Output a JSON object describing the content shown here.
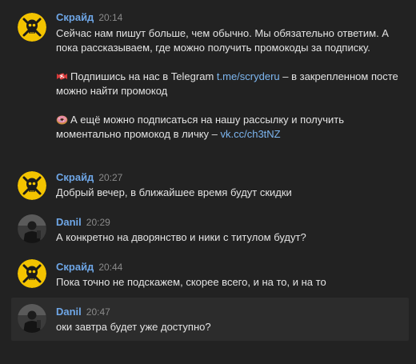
{
  "messages": [
    {
      "author": "Скрайд",
      "time": "20:14",
      "avatar": "skull-logo-avatar",
      "intro": "Сейчас нам пишут больше, чем обычно. Мы обязательно ответим. А пока рассказываем, где можно получить промокоды за подписку.",
      "promo1_emoji": "candy-icon",
      "promo1_text_before": "Подпишись на нас в Telegram ",
      "promo1_link": "t.me/scryderu",
      "promo1_text_after": " – в закрепленном посте можно найти промокод",
      "promo2_emoji": "donut-icon",
      "promo2_text_before": "А ещё можно подписаться на нашу рассылку и получить моментально промокод в личку – ",
      "promo2_link": "vk.cc/ch3tNZ"
    },
    {
      "author": "Скрайд",
      "time": "20:27",
      "avatar": "skull-logo-avatar",
      "text": "Добрый вечер, в ближайшее время будут скидки"
    },
    {
      "author": "Danil",
      "time": "20:29",
      "avatar": "user-photo-avatar",
      "text": "А конкретно на дворянство и ники с титулом будут?"
    },
    {
      "author": "Скрайд",
      "time": "20:44",
      "avatar": "skull-logo-avatar",
      "text": "Пока точно не подскажем, скорее всего, и на то, и на то"
    },
    {
      "author": "Danil",
      "time": "20:47",
      "avatar": "user-photo-avatar",
      "text": "оки завтра будет уже доступно?"
    }
  ],
  "colors": {
    "background": "#222222",
    "highlight": "#2c2c2c",
    "author": "#6ea6e6",
    "link": "#7db6f0",
    "text": "#e3e3e3",
    "time": "#8a8a8a",
    "logo_bg": "#f3c300"
  }
}
